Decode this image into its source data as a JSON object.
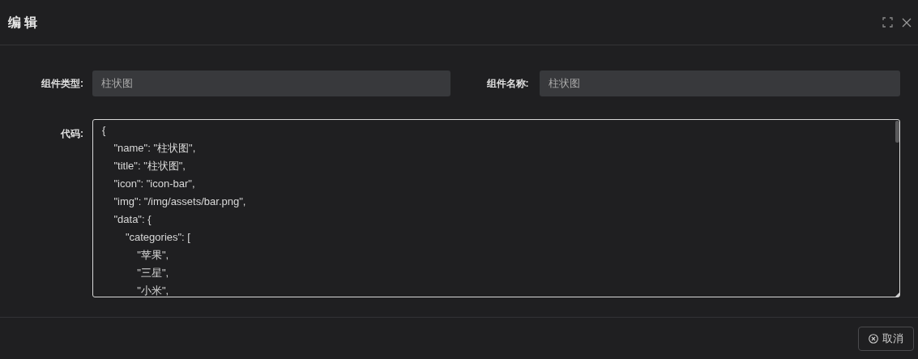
{
  "dialog": {
    "title": "编 辑"
  },
  "fields": [
    {
      "label": "组件类型:",
      "value": "柱状图"
    },
    {
      "label": "组件名称:",
      "value": "柱状图"
    }
  ],
  "code": {
    "label": "代码:",
    "value": "{\n    \"name\": \"柱状图\",\n    \"title\": \"柱状图\",\n    \"icon\": \"icon-bar\",\n    \"img\": \"/img/assets/bar.png\",\n    \"data\": {\n        \"categories\": [\n            \"苹果\",\n            \"三星\",\n            \"小米\","
  },
  "footer": {
    "cancel_button": "取消"
  }
}
